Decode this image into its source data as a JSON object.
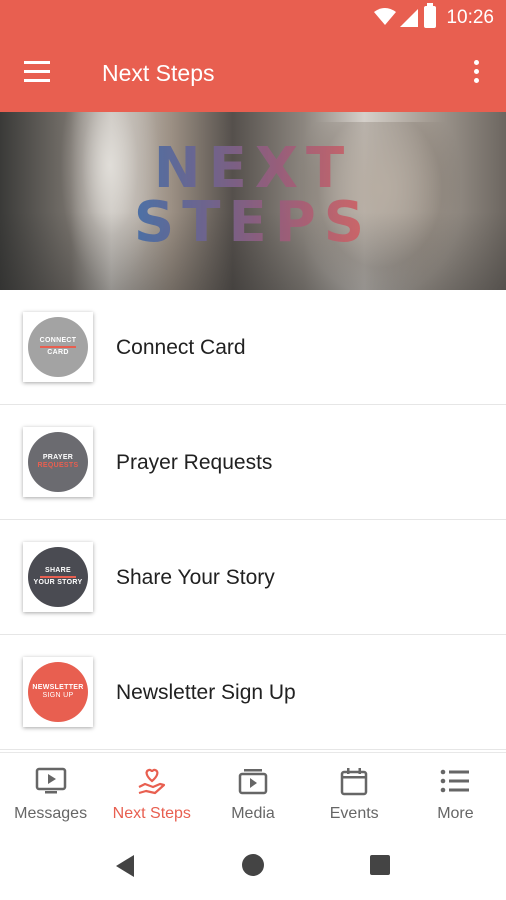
{
  "status_bar": {
    "time": "10:26"
  },
  "app_bar": {
    "title": "Next Steps"
  },
  "hero": {
    "title_line1": "NEXT",
    "title_line2": "STEPS"
  },
  "list": [
    {
      "label": "Connect Card",
      "thumb_line1": "CONNECT",
      "thumb_line2": "CARD",
      "thumb_color": "#a3a3a3"
    },
    {
      "label": "Prayer Requests",
      "thumb_line1": "PRAYER",
      "thumb_line2": "REQUESTS",
      "thumb_color": "#6b6b70"
    },
    {
      "label": "Share Your Story",
      "thumb_line1": "SHARE",
      "thumb_line2": "YOUR STORY",
      "thumb_color": "#4a4b52"
    },
    {
      "label": "Newsletter Sign Up",
      "thumb_line1": "NEWSLETTER",
      "thumb_line2": "SIGN UP",
      "thumb_color": "#e85f50"
    }
  ],
  "bottom_nav": {
    "tabs": [
      {
        "label": "Messages",
        "icon": "tv-play-icon"
      },
      {
        "label": "Next Steps",
        "icon": "hand-heart-icon",
        "active": true
      },
      {
        "label": "Media",
        "icon": "media-play-icon"
      },
      {
        "label": "Events",
        "icon": "calendar-icon"
      },
      {
        "label": "More",
        "icon": "list-icon"
      }
    ]
  },
  "colors": {
    "accent": "#e85f50",
    "inactive": "#666666"
  }
}
